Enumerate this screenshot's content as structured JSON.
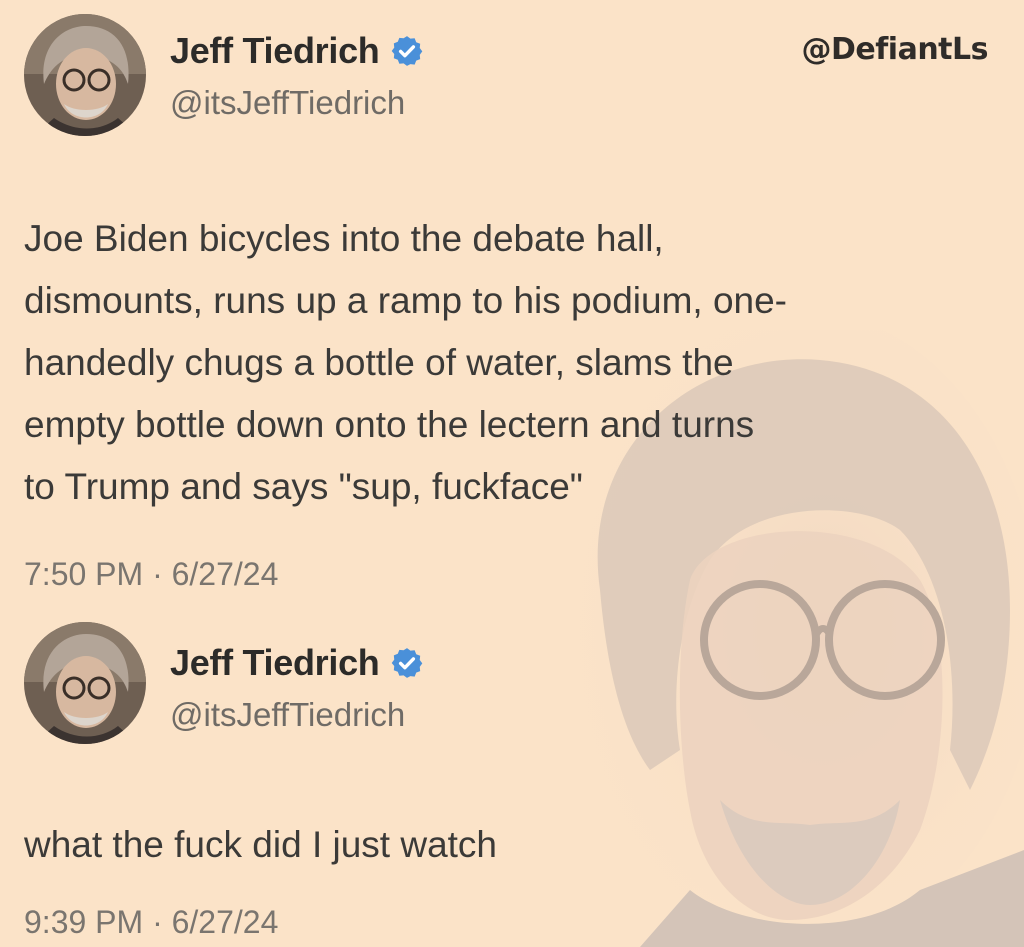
{
  "watermark": "@DefiantLs",
  "tweets": [
    {
      "author": {
        "name": "Jeff Tiedrich",
        "handle": "@itsJeffTiedrich",
        "verified": true
      },
      "text": "Joe Biden bicycles into the debate hall,\ndismounts, runs up a ramp to his podium, one-\nhandedly chugs a bottle of water, slams the\nempty bottle down onto the lectern and turns\nto Trump and says \"sup, fuckface\"",
      "timestamp": "7:50 PM · 6/27/24"
    },
    {
      "author": {
        "name": "Jeff Tiedrich",
        "handle": "@itsJeffTiedrich",
        "verified": true
      },
      "text": "what the fuck did I just watch",
      "timestamp": "9:39 PM · 6/27/24"
    }
  ],
  "colors": {
    "background": "#fbe3c8",
    "verified": "#4a90d9",
    "text": "#3b3a38",
    "muted": "#6f6b66"
  },
  "icons": {
    "verified": "verified-badge-icon"
  }
}
